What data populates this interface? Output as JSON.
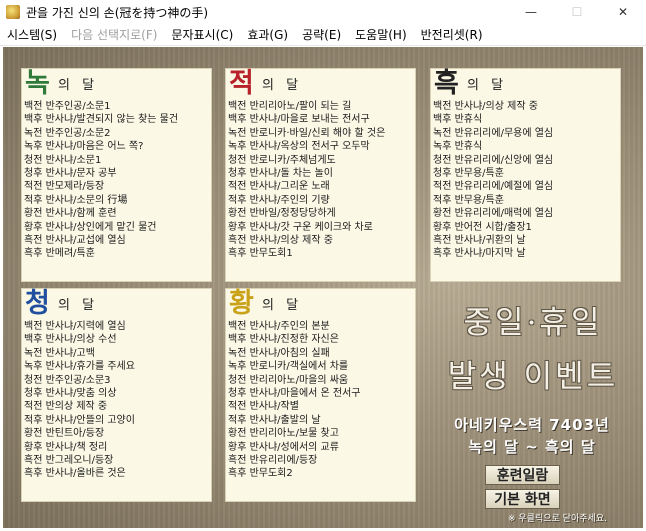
{
  "window": {
    "title": "관을 가진 신의 손(冠を持つ神の手)",
    "min_label": "—",
    "max_label": "☐",
    "close_label": "✕"
  },
  "menu": [
    {
      "label": "시스템(S)",
      "enabled": true
    },
    {
      "label": "다음 선택지로(F)",
      "enabled": false
    },
    {
      "label": "문자표시(C)",
      "enabled": true
    },
    {
      "label": "효과(G)",
      "enabled": true
    },
    {
      "label": "공략(E)",
      "enabled": true
    },
    {
      "label": "도움말(H)",
      "enabled": true
    },
    {
      "label": "반전리셋(R)",
      "enabled": true
    }
  ],
  "panels": [
    {
      "big": "녹",
      "small": "의 달",
      "color": "#2f7a3a",
      "items": [
        "백전 반주인공/소문1",
        "백후 반사냐/발견되지 않는 찾는 물건",
        "녹전 반주인공/소문2",
        "녹후 반사냐/마음은 어느 쪽?",
        "청전 반사냐/소문1",
        "청후 반사냐/문자 공부",
        "적전 반모제라/등장",
        "적후 반사냐/소문의 行場",
        "황전 반사냐/함께 훈련",
        "황후 반사냐/상인에게 맡긴 물건",
        "흑전 반사냐/교섭에 열심",
        "흑후 반메려/특훈"
      ]
    },
    {
      "big": "적",
      "small": "의 달",
      "color": "#b8222a",
      "items": [
        "백전 반리리아노/팔이 되는 길",
        "백후 반사냐/마을로 보내는 전서구",
        "녹전 반로니카·바일/신뢰 해야 할 것은",
        "녹후 반사냐/옥상의 전서구 오두막",
        "청전 반로니카/주체넘게도",
        "청후 반사냐/돌 차는 놀이",
        "적전 반사냐/그리운 노래",
        "적후 반사냐/주인의 기량",
        "황전 반바일/정정당당하게",
        "황후 반사냐/갓 구운 케이크와 차로",
        "흑전 반사냐/의상 제작 중",
        "흑후 반무도회1"
      ]
    },
    {
      "big": "흑",
      "small": "의 달",
      "color": "#222222",
      "items": [
        "백전 반사냐/의상 제작 중",
        "백후 반휴식",
        "녹전 반유리리에/무용에 열심",
        "녹후 반휴식",
        "청전 반유리리에/신앙에 열심",
        "청후 반무용/특훈",
        "적전 반유리리에/예절에 열심",
        "적후 반무용/특훈",
        "황전 반유리리에/매력에 열심",
        "황후 반어전 시합/출장1",
        "흑전 반사냐/귀환의 날",
        "흑후 반사냐/마지막 날"
      ]
    },
    {
      "big": "청",
      "small": "의 달",
      "color": "#1f4f9e",
      "items": [
        "백전 반사냐/지력에 열심",
        "백후 반사냐/의상 수선",
        "녹전 반사냐/고백",
        "녹후 반사냐/휴가를 주세요",
        "청전 반주인공/소문3",
        "청후 반사냐/맞춤 의상",
        "적전 반의상 제작 중",
        "적후 반사냐/안뜰의 고양이",
        "황전 반틴트아/등장",
        "황후 반사냐/책 정리",
        "흑전 반그레오니/등장",
        "흑후 반사냐/올바른 것은"
      ]
    },
    {
      "big": "황",
      "small": "의 달",
      "color": "#c9a21a",
      "items": [
        "백전 반사냐/주인의 본분",
        "백후 반사냐/진정한 자신은",
        "녹전 반사냐/아침의 실패",
        "녹후 반로니카/객실에서 차를",
        "청전 반리리아노/마을의 싸움",
        "청후 반사냐/마을에서 온 전서구",
        "적전 반사냐/작별",
        "적후 반사냐/출발의 날",
        "황전 반리리아노/보물 찾고",
        "황후 반사냐/성에서의 교류",
        "흑전 반유리리에/등장",
        "흑후 반무도회2"
      ]
    }
  ],
  "right": {
    "title_line1": "중일·휴일",
    "title_line2": "발생 이벤트",
    "info_line1": "아네키우스력 7403년",
    "info_line2": "녹의 달 ~ 흑의 달",
    "button_training": "훈련일람",
    "button_home": "기본 화면",
    "hint": "※ 우클릭으로 닫아주세요."
  }
}
